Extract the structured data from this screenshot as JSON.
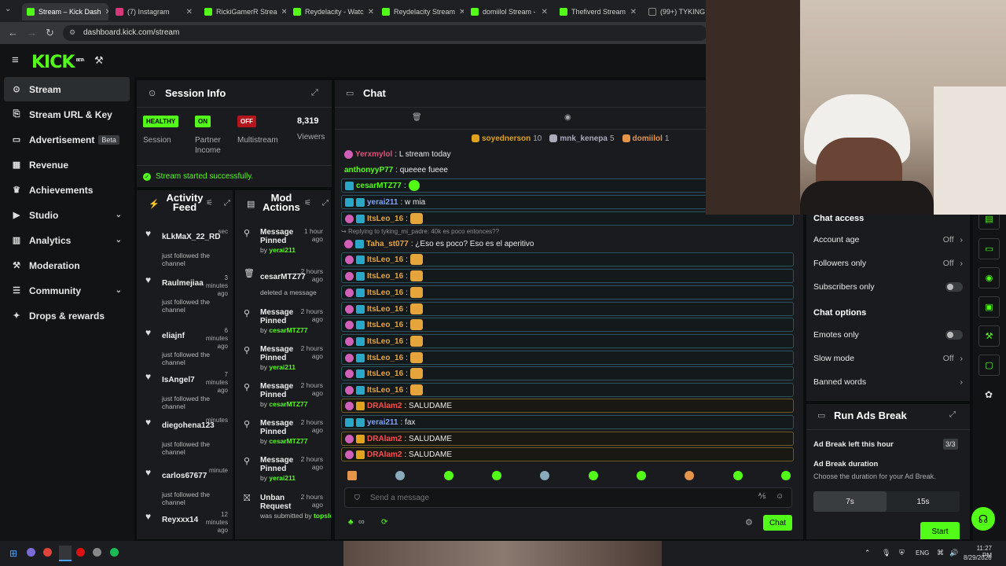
{
  "browser": {
    "tabs": [
      {
        "title": "Stream – Kick Dash",
        "icon": "kick",
        "active": true
      },
      {
        "title": "(7) Instagram",
        "icon": "instagram"
      },
      {
        "title": "RickiGamerR Strea",
        "icon": "kick"
      },
      {
        "title": "Reydelacity - Watc",
        "icon": "kick"
      },
      {
        "title": "Reydelacity Stream",
        "icon": "kick"
      },
      {
        "title": "domiilol Stream - ",
        "icon": "kick"
      },
      {
        "title": "Thefiverd Stream",
        "icon": "kick"
      },
      {
        "title": "(99+) TYKING",
        "icon": "tiktok"
      }
    ],
    "url": "dashboard.kick.com/stream"
  },
  "kick": {
    "logo": "KICK",
    "logo_sup": "BETA"
  },
  "sidebar": {
    "items": [
      {
        "label": "Stream",
        "icon": "stream-icon",
        "active": true
      },
      {
        "label": "Stream URL & Key",
        "icon": "key-icon"
      },
      {
        "label": "Advertisement",
        "icon": "ad-icon",
        "badge": "Beta"
      },
      {
        "label": "Revenue",
        "icon": "revenue-icon"
      },
      {
        "label": "Achievements",
        "icon": "trophy-icon"
      },
      {
        "label": "Studio",
        "icon": "studio-icon",
        "expand": true
      },
      {
        "label": "Analytics",
        "icon": "analytics-icon",
        "expand": true
      },
      {
        "label": "Moderation",
        "icon": "hammer-icon"
      },
      {
        "label": "Community",
        "icon": "community-icon",
        "expand": true
      },
      {
        "label": "Drops & rewards",
        "icon": "gift-icon"
      }
    ]
  },
  "session": {
    "title": "Session Info",
    "stats": [
      {
        "badge": "HEALTHY",
        "label": "Session",
        "color": "#53fc18"
      },
      {
        "badge": "ON",
        "label": "Partner Income",
        "color": "#53fc18"
      },
      {
        "badge": "OFF",
        "label": "Multistream",
        "color": "#e0262c"
      },
      {
        "value": "8,319",
        "label": "Viewers"
      }
    ],
    "status": "Stream started successfully."
  },
  "activity": {
    "title": "Activity Feed",
    "items": [
      {
        "user": "kLkMaX_22_RD",
        "time": "sec",
        "desc": "just followed the channel"
      },
      {
        "user": "Raulmejiaa",
        "time": "3 minutes ago",
        "desc": "just followed the channel"
      },
      {
        "user": "eliajnf",
        "time": "6 minutes ago",
        "desc": "just followed the channel"
      },
      {
        "user": "IsAngel7",
        "time": "7 minutes ago",
        "desc": "just followed the channel"
      },
      {
        "user": "diegohena123",
        "time": "minutes",
        "desc": "just followed the channel"
      },
      {
        "user": "carlos67677",
        "time": "minute",
        "desc": "just followed the channel"
      },
      {
        "user": "Reyxxx14",
        "time": "12 minutes ago",
        "desc": ""
      }
    ]
  },
  "mod": {
    "title": "Mod Actions",
    "items": [
      {
        "action": "Message Pinned",
        "time": "1 hour ago",
        "by": "by",
        "who": "yerai211",
        "icon": "pin-icon"
      },
      {
        "action": "cesarMTZ77",
        "time": "2 hours ago",
        "by": "deleted a message",
        "who": "",
        "icon": "trash-icon"
      },
      {
        "action": "Message Pinned",
        "time": "2 hours ago",
        "by": "by",
        "who": "cesarMTZ77",
        "icon": "pin-icon"
      },
      {
        "action": "Message Pinned",
        "time": "2 hours ago",
        "by": "by",
        "who": "yerai211",
        "icon": "pin-icon"
      },
      {
        "action": "Message Pinned",
        "time": "2 hours ago",
        "by": "by",
        "who": "cesarMTZ77",
        "icon": "pin-icon"
      },
      {
        "action": "Message Pinned",
        "time": "2 hours ago",
        "by": "by",
        "who": "cesarMTZ77",
        "icon": "pin-icon"
      },
      {
        "action": "Message Pinned",
        "time": "2 hours ago",
        "by": "by",
        "who": "yerai211",
        "icon": "pin-icon"
      },
      {
        "action": "Unban Request",
        "time": "2 hours ago",
        "by": "was submitted by",
        "who": "topslosmusicant",
        "icon": "unban-icon"
      }
    ]
  },
  "chat": {
    "title": "Chat",
    "top_gifters": [
      {
        "name": "soyednerson",
        "count": "10",
        "color": "#e1a21d"
      },
      {
        "name": "mnk_kenepa",
        "count": "5",
        "color": "#aab"
      },
      {
        "name": "domiilol",
        "count": "1",
        "color": "#e6944a"
      }
    ],
    "reply_note": "Replying to tyking_mi_padre: 40k es poco entonces??",
    "messages": [
      {
        "user": "Yerxmylol",
        "color": "#e0507e",
        "text": ": L stream today",
        "badges": [
          "pink"
        ],
        "style": ""
      },
      {
        "user": "anthonyyP77",
        "color": "#53fc18",
        "text": ": queeee fueee",
        "badges": [],
        "style": ""
      },
      {
        "user": "cesarMTZ77",
        "color": "#53fc18",
        "text": ":",
        "badges": [
          "teal"
        ],
        "style": "hl",
        "emote": "green"
      },
      {
        "user": "yerai211",
        "color": "#7fa3ff",
        "text": ": w mia",
        "badges": [
          "teal",
          "teal"
        ],
        "style": "hl"
      },
      {
        "user": "ItsLeo_16",
        "color": "#e6a43c",
        "text": ":",
        "badges": [
          "pink",
          "teal"
        ],
        "style": "hl",
        "emote": "gold"
      },
      {
        "user": "Taha_st077",
        "color": "#e6a43c",
        "text": ": ¿Eso es poco? Eso es el aperitivo",
        "badges": [
          "pink",
          "teal"
        ],
        "style": ""
      },
      {
        "user": "ItsLeo_16",
        "color": "#e6a43c",
        "text": ":",
        "badges": [
          "pink",
          "teal"
        ],
        "style": "hl",
        "emote": "gold"
      },
      {
        "user": "ItsLeo_16",
        "color": "#e6a43c",
        "text": ":",
        "badges": [
          "pink",
          "teal"
        ],
        "style": "hl",
        "emote": "gold"
      },
      {
        "user": "ItsLeo_16",
        "color": "#e6a43c",
        "text": ":",
        "badges": [
          "pink",
          "teal"
        ],
        "style": "hl",
        "emote": "gold"
      },
      {
        "user": "ItsLeo_16",
        "color": "#e6a43c",
        "text": ":",
        "badges": [
          "pink",
          "teal"
        ],
        "style": "hl",
        "emote": "gold"
      },
      {
        "user": "ItsLeo_16",
        "color": "#e6a43c",
        "text": ":",
        "badges": [
          "pink",
          "teal"
        ],
        "style": "hl",
        "emote": "gold"
      },
      {
        "user": "ItsLeo_16",
        "color": "#e6a43c",
        "text": ":",
        "badges": [
          "pink",
          "teal"
        ],
        "style": "hl",
        "emote": "gold"
      },
      {
        "user": "ItsLeo_16",
        "color": "#e6a43c",
        "text": ":",
        "badges": [
          "pink",
          "teal"
        ],
        "style": "hl",
        "emote": "gold"
      },
      {
        "user": "ItsLeo_16",
        "color": "#e6a43c",
        "text": ":",
        "badges": [
          "pink",
          "teal"
        ],
        "style": "hl",
        "emote": "gold"
      },
      {
        "user": "ItsLeo_16",
        "color": "#e6a43c",
        "text": ":",
        "badges": [
          "pink",
          "teal"
        ],
        "style": "hl",
        "emote": "gold"
      },
      {
        "user": "DRAlam2",
        "color": "#ff4d4d",
        "text": ": SALUDAME",
        "badges": [
          "pink",
          "gold"
        ],
        "style": "gold"
      },
      {
        "user": "yerai211",
        "color": "#7fa3ff",
        "text": ": fax",
        "badges": [
          "teal",
          "teal"
        ],
        "style": "hl"
      },
      {
        "user": "DRAlam2",
        "color": "#ff4d4d",
        "text": ": SALUDAME",
        "badges": [
          "pink",
          "gold"
        ],
        "style": "gold"
      },
      {
        "user": "DRAlam2",
        "color": "#ff4d4d",
        "text": ": SALUDAME",
        "badges": [
          "pink",
          "gold"
        ],
        "style": "gold"
      }
    ],
    "placeholder": "Send a message",
    "send": "Chat"
  },
  "chat_settings": {
    "access_title": "Chat access",
    "access": [
      {
        "label": "Account age",
        "value": "Off"
      },
      {
        "label": "Followers only",
        "value": "Off"
      },
      {
        "label": "Subscribers only",
        "toggle": true
      }
    ],
    "options_title": "Chat options",
    "options": [
      {
        "label": "Emotes only",
        "toggle": true
      },
      {
        "label": "Slow mode",
        "value": "Off"
      },
      {
        "label": "Banned words",
        "value": ""
      }
    ]
  },
  "ads": {
    "title": "Run Ads Break",
    "left_label": "Ad Break left this hour",
    "left_value": "3/3",
    "duration_label": "Ad Break duration",
    "duration_desc": "Choose the duration for your Ad Break.",
    "options": [
      "7s",
      "15s"
    ],
    "start": "Start"
  },
  "taskbar": {
    "lang": "ENG",
    "time": "11:27 PM",
    "date": "8/29/2026"
  },
  "colors": {
    "accent": "#53fc18",
    "panel": "#191b1f",
    "bg": "#0b0e0f"
  }
}
